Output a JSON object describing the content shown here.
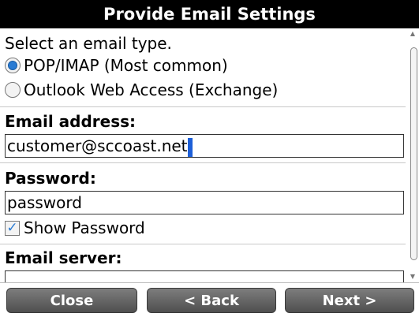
{
  "title": "Provide Email Settings",
  "intro": "Select an email type.",
  "email_types": [
    {
      "label": "POP/IMAP (Most common)",
      "selected": true
    },
    {
      "label": "Outlook Web Access (Exchange)",
      "selected": false
    }
  ],
  "email_address": {
    "label": "Email address:",
    "value": "customer@sccoast.net"
  },
  "password": {
    "label": "Password:",
    "value": "password"
  },
  "show_password": {
    "label": "Show Password",
    "checked": true
  },
  "email_server": {
    "label": "Email server:",
    "value": ""
  },
  "buttons": {
    "close": "Close",
    "back": "< Back",
    "next": "Next >"
  },
  "colors": {
    "accent": "#2a7bd3",
    "title_bg": "#000000",
    "button_bg": "#5f5f5f"
  }
}
